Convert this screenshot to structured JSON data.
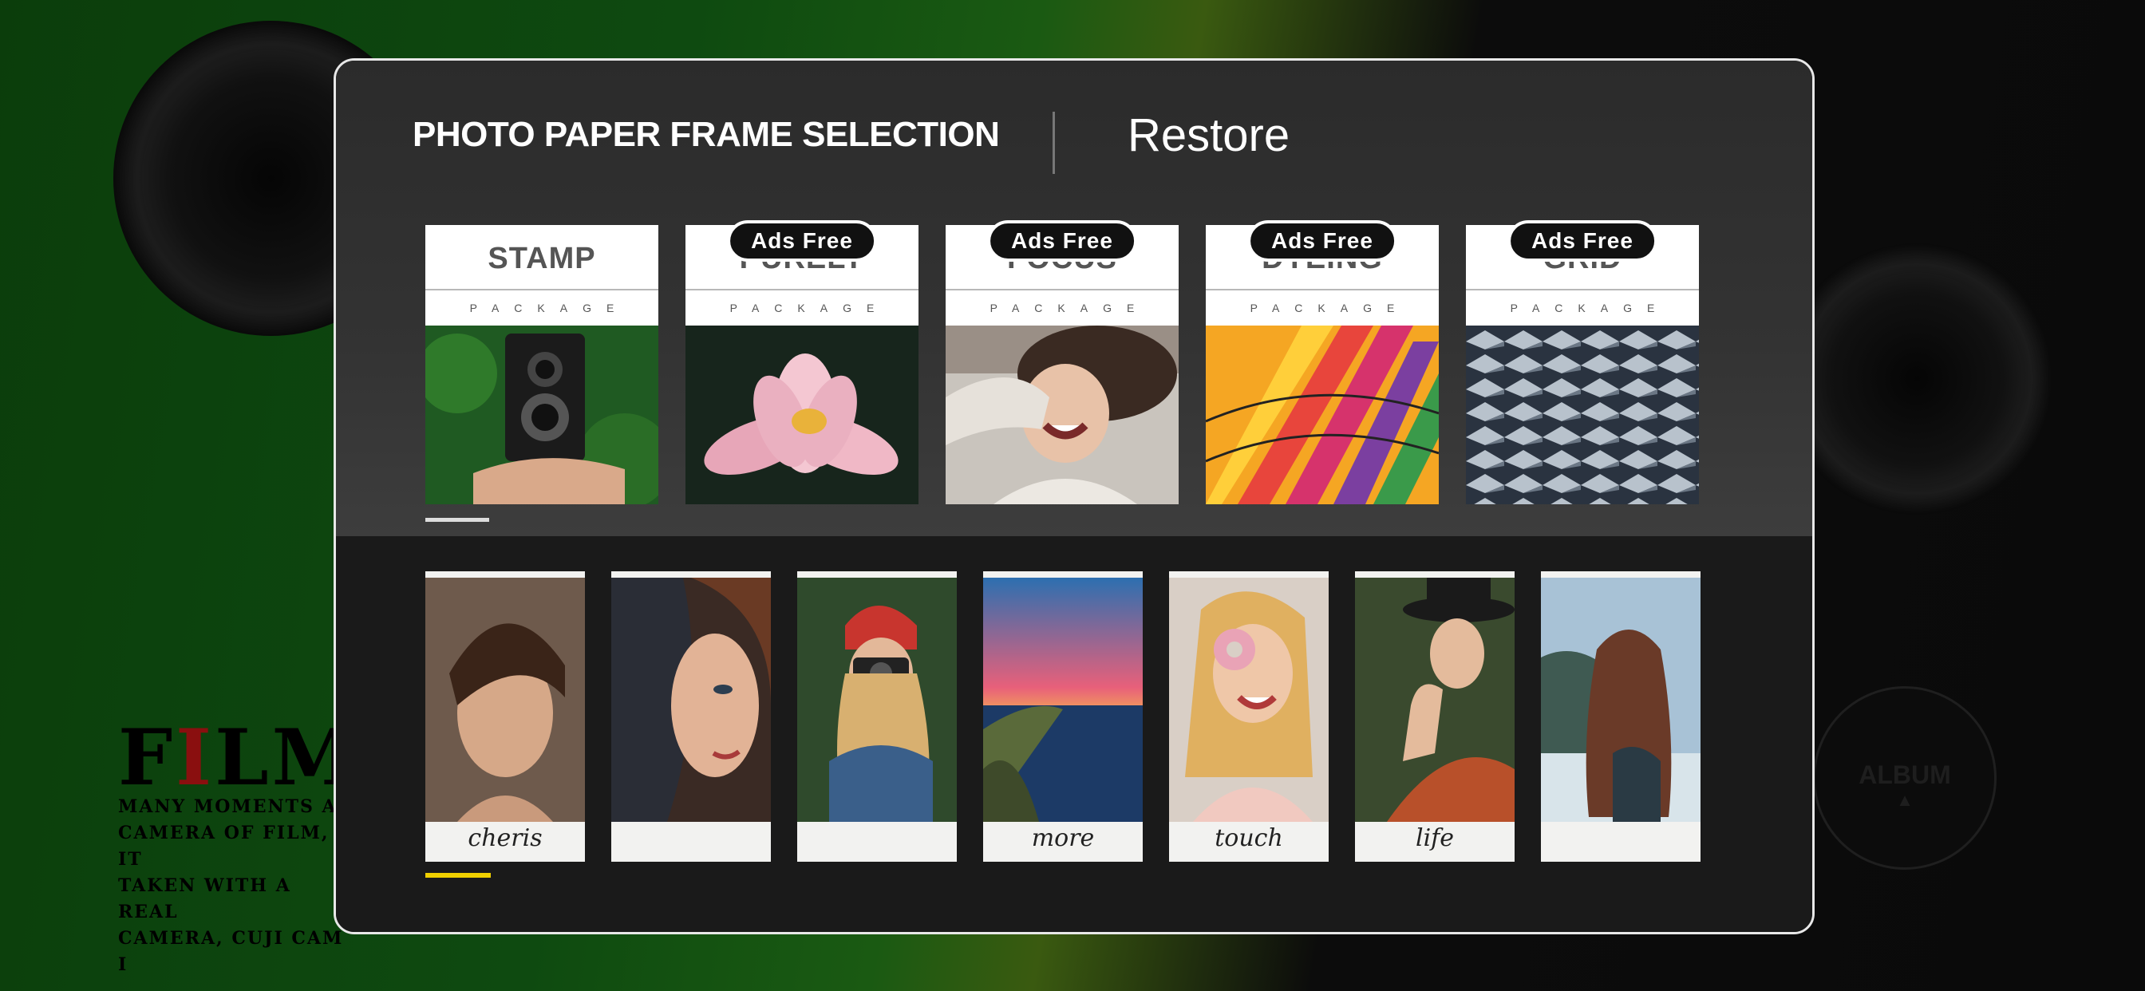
{
  "header": {
    "title": "PHOTO PAPER FRAME SELECTION",
    "restore_label": "Restore"
  },
  "packages": [
    {
      "name": "STAMP",
      "sub": "PACKAGE",
      "badge": null,
      "image": "vintage-camera-photo"
    },
    {
      "name": "PURELY",
      "sub": "PACKAGE",
      "badge": "Ads Free",
      "image": "lotus-flower-photo"
    },
    {
      "name": "FOCUS",
      "sub": "PACKAGE",
      "badge": "Ads Free",
      "image": "laughing-woman-photo"
    },
    {
      "name": "DYEING",
      "sub": "PACKAGE",
      "badge": "Ads Free",
      "image": "hot-air-balloon-photo"
    },
    {
      "name": "GRID",
      "sub": "PACKAGE",
      "badge": "Ads Free",
      "image": "architecture-grid-photo"
    }
  ],
  "frames": [
    {
      "caption": "cheris",
      "image": "man-portrait-photo"
    },
    {
      "caption": "",
      "image": "woman-half-face-photo"
    },
    {
      "caption": "",
      "image": "woman-with-camera-photo"
    },
    {
      "caption": "more",
      "image": "sunset-lake-photo"
    },
    {
      "caption": "touch",
      "image": "woman-donut-photo"
    },
    {
      "caption": "life",
      "image": "woman-hat-photo"
    },
    {
      "caption": "",
      "image": "woman-back-photo"
    }
  ],
  "background": {
    "film_title_a": "F",
    "film_title_b": "I",
    "film_title_c": "LM",
    "film_lines": [
      "MANY MOMENTS AR",
      "CAMERA OF FILM, IT",
      "TAKEN WITH A REAL",
      "CAMERA, CUJI CAM I"
    ],
    "album_label": "ALBUM"
  },
  "colors": {
    "accent_indicator": "#f0d000",
    "panel_border": "#e8e8e8"
  }
}
